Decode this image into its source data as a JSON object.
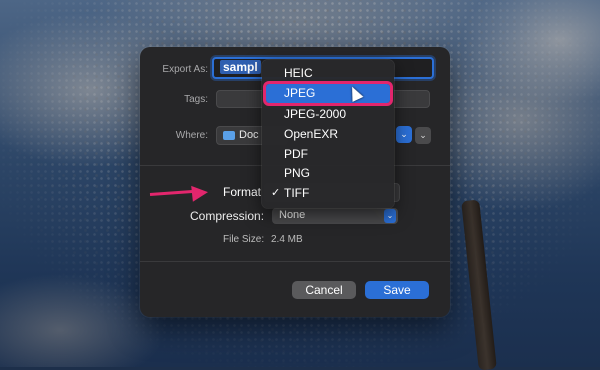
{
  "dialog": {
    "export_as_label": "Export As:",
    "export_as_value": "sampl",
    "tags_label": "Tags:",
    "where_label": "Where:",
    "where_value": "Doc",
    "format_label": "Format",
    "compression_label": "Compression:",
    "compression_value": "None",
    "file_size_label": "File Size:",
    "file_size_value": "2.4 MB",
    "cancel_label": "Cancel",
    "save_label": "Save"
  },
  "format_menu": {
    "items": [
      {
        "label": "HEIC"
      },
      {
        "label": "JPEG"
      },
      {
        "label": "JPEG-2000"
      },
      {
        "label": "OpenEXR"
      },
      {
        "label": "PDF"
      },
      {
        "label": "PNG"
      },
      {
        "label": "TIFF"
      }
    ],
    "highlighted": "JPEG",
    "checked": "TIFF"
  },
  "icons": {
    "check": "✓",
    "stepper": "⌃⌄",
    "expand": "⌄",
    "folder": "folder-icon",
    "cursor": "cursor-icon",
    "arrow": "arrow-annotation"
  },
  "colors": {
    "accent": "#2b6fd6",
    "highlight_outline": "#e2266d",
    "dialog_bg": "#262628"
  }
}
